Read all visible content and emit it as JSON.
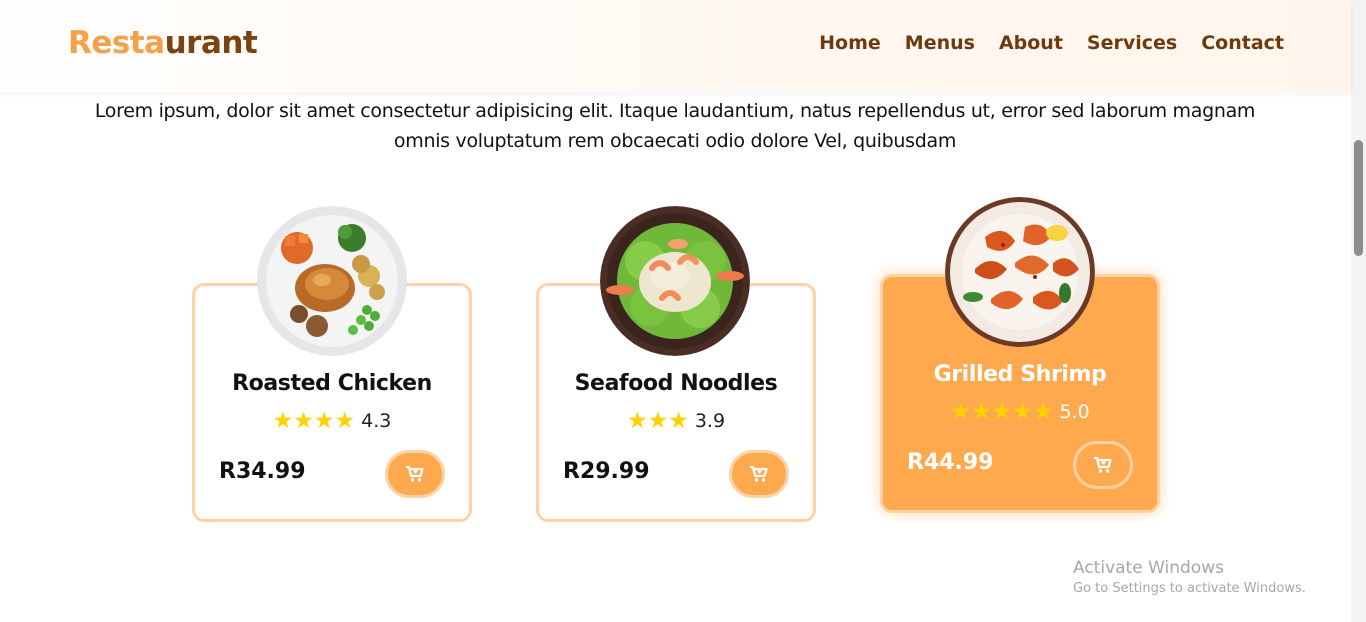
{
  "header": {
    "logo_part1": "Resta",
    "logo_part2": "urant",
    "nav": [
      "Home",
      "Menus",
      "About",
      "Services",
      "Contact"
    ]
  },
  "intro_text": "Lorem ipsum, dolor sit amet consectetur adipisicing elit. Itaque laudantium, natus repellendus ut, error sed laborum magnam omnis voluptatum rem obcaecati odio dolore Vel, quibusdam",
  "cards": [
    {
      "name": "Roasted Chicken",
      "stars": 4,
      "rating": "4.3",
      "price": "R34.99",
      "active": false,
      "cart_icon": "cart-icon"
    },
    {
      "name": "Seafood Noodles",
      "stars": 3,
      "rating": "3.9",
      "price": "R29.99",
      "active": false,
      "cart_icon": "cart-icon"
    },
    {
      "name": "Grilled Shrimp",
      "stars": 5,
      "rating": "5.0",
      "price": "R44.99",
      "active": true,
      "cart_icon": "cart-icon"
    }
  ],
  "watermark": {
    "title": "Activate Windows",
    "subtitle": "Go to Settings to activate Windows."
  },
  "colors": {
    "accent": "#ffa94f",
    "accent_light": "#ffd2a3",
    "logo_light": "#f5a14a",
    "logo_dark": "#7b4212",
    "nav": "#6e3a0d",
    "star": "#ffd200"
  }
}
